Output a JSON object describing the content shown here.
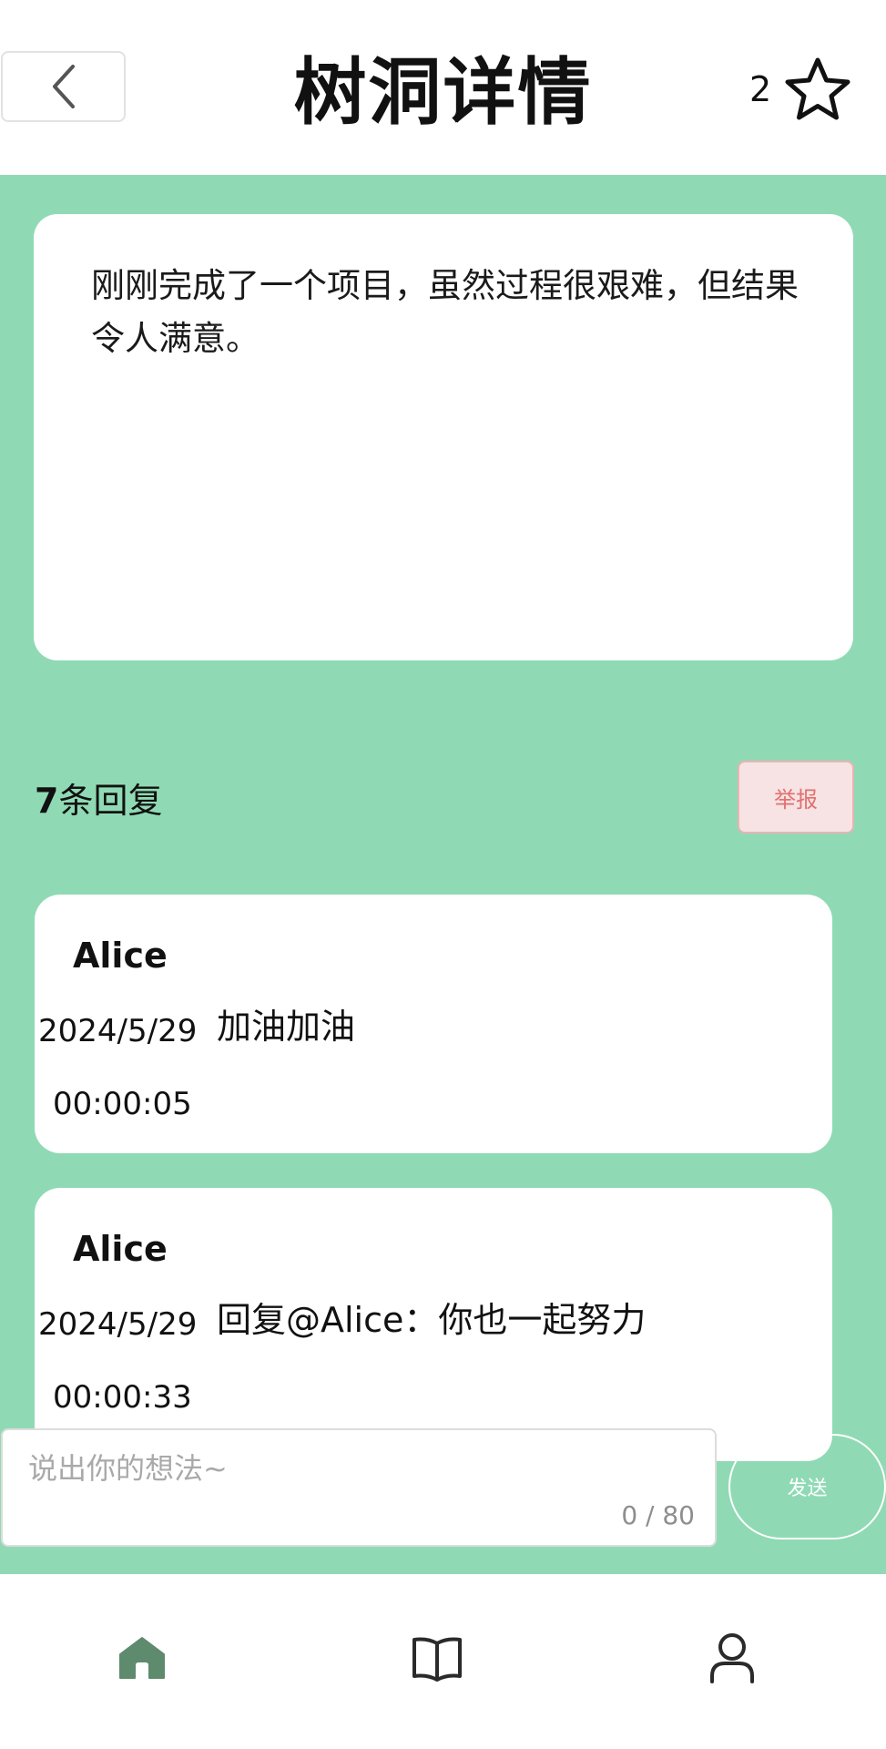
{
  "header": {
    "title": "树洞详情",
    "star_count": "2",
    "back_icon": "chevron-left-icon",
    "star_icon": "star-outline-icon"
  },
  "post": {
    "content": "刚刚完成了一个项目，虽然过程很艰难，但结果令人满意。"
  },
  "replies_header": {
    "count": "7",
    "label": "条回复",
    "report_label": "举报"
  },
  "replies": [
    {
      "author": "Alice",
      "date": "2024/5/29",
      "time": "00:00:05",
      "text": "加油加油"
    },
    {
      "author": "Alice",
      "date": "2024/5/29",
      "time": "00:00:33",
      "text": "回复@Alice：你也一起努力"
    }
  ],
  "composer": {
    "placeholder": "说出你的想法~",
    "char_count": "0 / 80",
    "send_label": "发送"
  },
  "nav": [
    {
      "icon": "home-icon",
      "active": true
    },
    {
      "icon": "book-icon",
      "active": false
    },
    {
      "icon": "user-icon",
      "active": false
    }
  ],
  "colors": {
    "background": "#8fdab4",
    "nav_active": "#5e8a6e",
    "report_text": "#e17070"
  }
}
